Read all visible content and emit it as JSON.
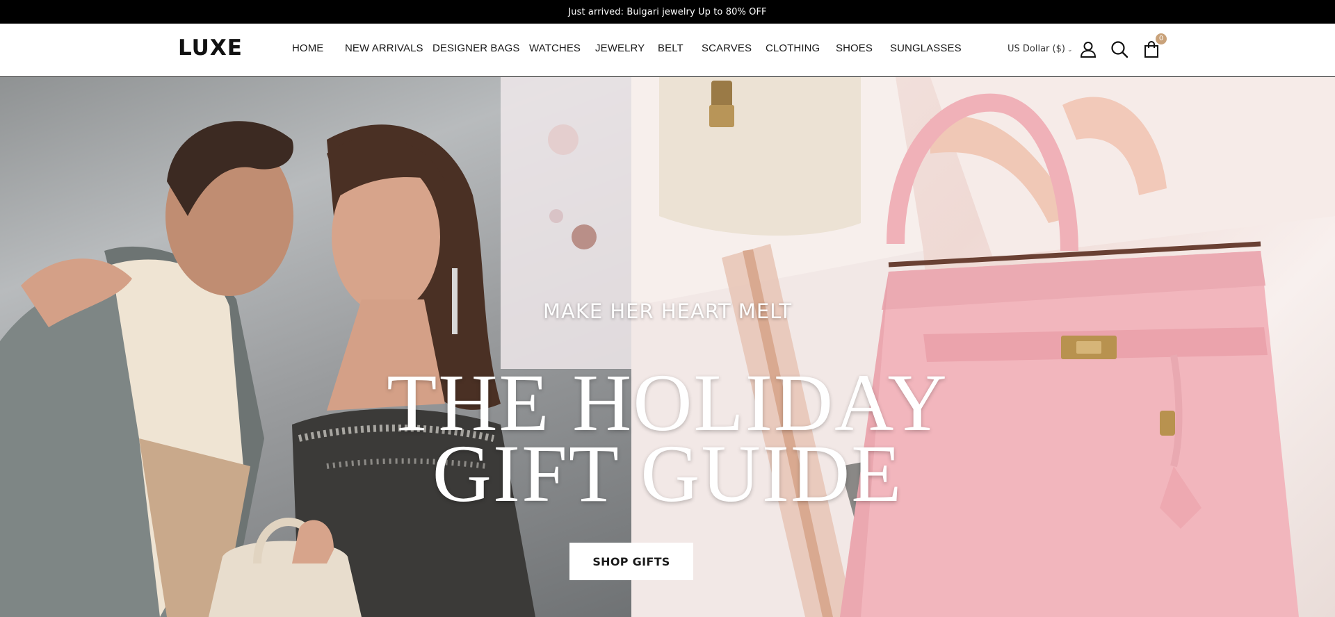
{
  "announcement": {
    "text": "Just arrived: Bulgari jewelry Up to 80% OFF"
  },
  "header": {
    "logo": "LUXE",
    "nav": [
      {
        "label": "HOME"
      },
      {
        "label": "NEW ARRIVALS"
      },
      {
        "label": "DESIGNER BAGS"
      },
      {
        "label": "WATCHES"
      },
      {
        "label": "JEWELRY"
      },
      {
        "label": "BELT"
      },
      {
        "label": "SCARVES"
      },
      {
        "label": "CLOTHING"
      },
      {
        "label": "SHOES"
      },
      {
        "label": "SUNGLASSES"
      }
    ],
    "currency": "US Dollar ($)",
    "icons": {
      "account": "user-icon",
      "search": "search-icon",
      "cart": "shopping-bag-icon"
    },
    "cart_count": "0"
  },
  "hero": {
    "subtitle": "MAKE HER HEART MELT",
    "title_line1": "THE HOLIDAY",
    "title_line2": "GIFT GUIDE",
    "cta": "SHOP GIFTS"
  },
  "colors": {
    "announcement_bg": "#000000",
    "badge": "#c9a27a",
    "bag_pink": "#f2b6bd"
  }
}
